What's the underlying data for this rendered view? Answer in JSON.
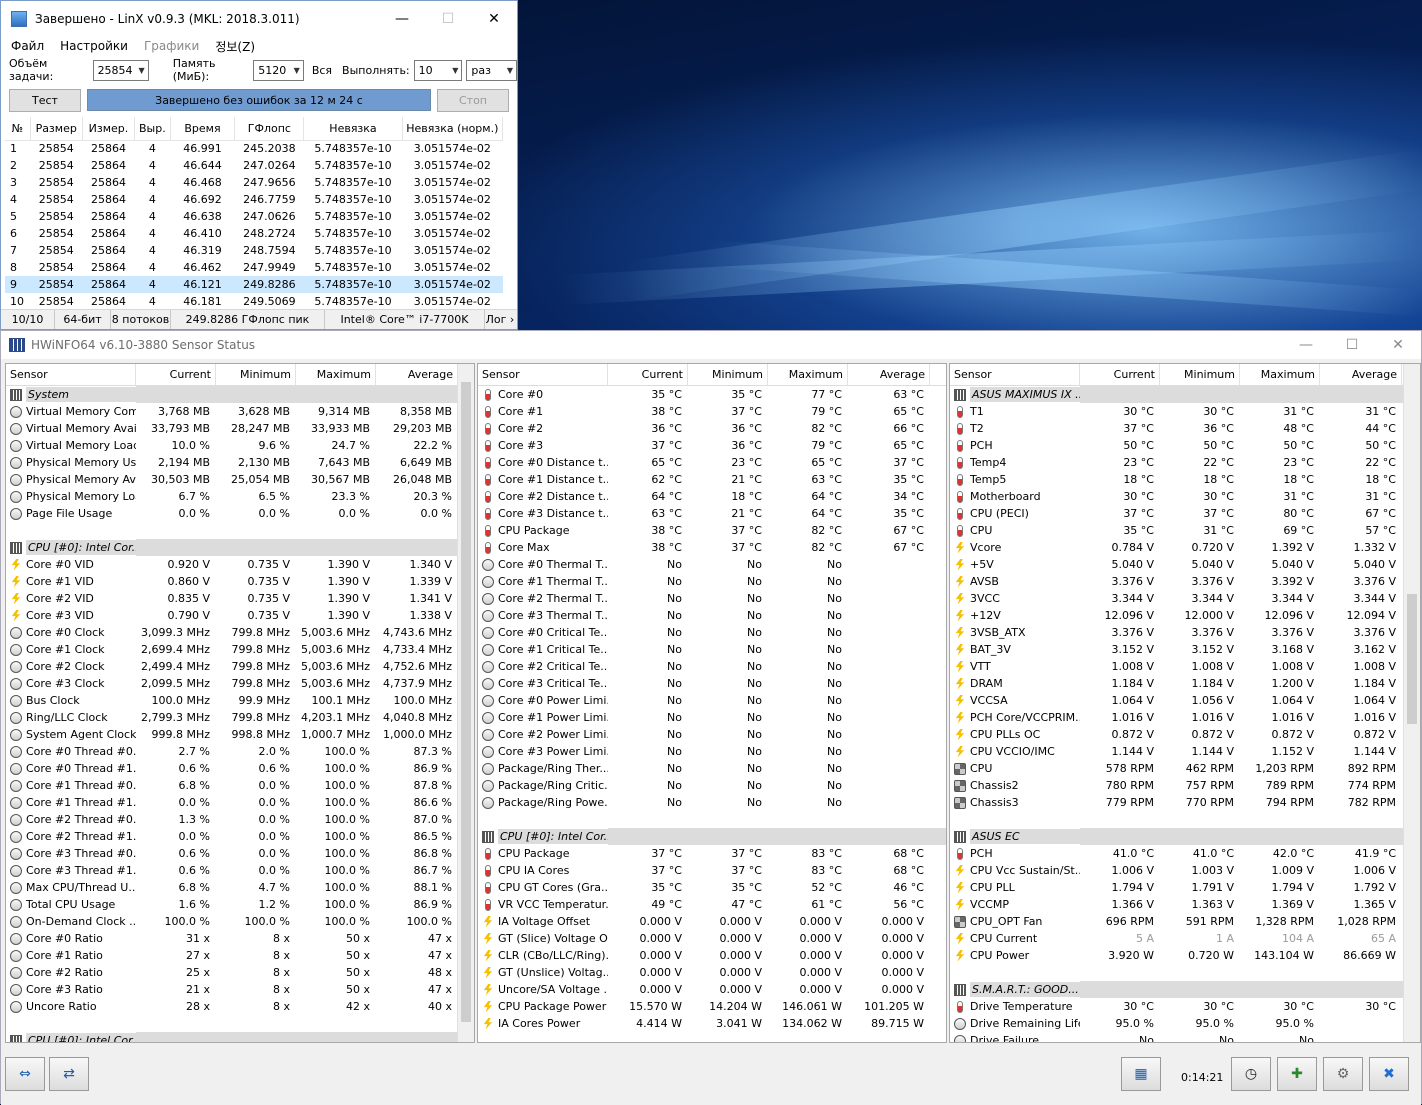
{
  "linx": {
    "title": "Завершено - LinX v0.9.3 (MKL: 2018.3.011)",
    "menu": [
      "Файл",
      "Настройки",
      "Графики",
      "정보(Z)"
    ],
    "params": {
      "size_label": "Объём задачи:",
      "size_value": "25854",
      "memory_label": "Память (МиБ):",
      "memory_value": "5120",
      "all_label": "Вся",
      "run_label": "Выполнять:",
      "run_value": "10",
      "unit_value": "раз"
    },
    "test_label": "Тест",
    "progress_text": "Завершено без ошибок за 12 м 24 с",
    "stop_label": "Стоп",
    "columns": [
      "№",
      "Размер",
      "Измер.",
      "Выр.",
      "Время",
      "ГФлопс",
      "Невязка",
      "Невязка (норм.)"
    ],
    "rows": [
      [
        "1",
        "25854",
        "25864",
        "4",
        "46.991",
        "245.2038",
        "5.748357e-10",
        "3.051574e-02"
      ],
      [
        "2",
        "25854",
        "25864",
        "4",
        "46.644",
        "247.0264",
        "5.748357e-10",
        "3.051574e-02"
      ],
      [
        "3",
        "25854",
        "25864",
        "4",
        "46.468",
        "247.9656",
        "5.748357e-10",
        "3.051574e-02"
      ],
      [
        "4",
        "25854",
        "25864",
        "4",
        "46.692",
        "246.7759",
        "5.748357e-10",
        "3.051574e-02"
      ],
      [
        "5",
        "25854",
        "25864",
        "4",
        "46.638",
        "247.0626",
        "5.748357e-10",
        "3.051574e-02"
      ],
      [
        "6",
        "25854",
        "25864",
        "4",
        "46.410",
        "248.2724",
        "5.748357e-10",
        "3.051574e-02"
      ],
      [
        "7",
        "25854",
        "25864",
        "4",
        "46.319",
        "248.7594",
        "5.748357e-10",
        "3.051574e-02"
      ],
      [
        "8",
        "25854",
        "25864",
        "4",
        "46.462",
        "247.9949",
        "5.748357e-10",
        "3.051574e-02"
      ],
      [
        "9",
        "25854",
        "25864",
        "4",
        "46.121",
        "249.8286",
        "5.748357e-10",
        "3.051574e-02"
      ],
      [
        "10",
        "25854",
        "25864",
        "4",
        "46.181",
        "249.5069",
        "5.748357e-10",
        "3.051574e-02"
      ]
    ],
    "selected_row": 8,
    "status": [
      "10/10",
      "64-бит",
      "8 потоков",
      "249.8286 ГФлопс пик",
      "Intel® Core™ i7-7700K",
      "Лог ›"
    ]
  },
  "hw": {
    "title": "HWiNFO64 v6.10-3880 Sensor Status",
    "columns": [
      "Sensor",
      "Current",
      "Minimum",
      "Maximum",
      "Average"
    ],
    "time": "0:14:21",
    "panels": [
      [
        [
          "g",
          "System"
        ],
        [
          "c",
          "Virtual Memory Com...",
          "3,768 MB",
          "3,628 MB",
          "9,314 MB",
          "8,358 MB"
        ],
        [
          "c",
          "Virtual Memory Avai...",
          "33,793 MB",
          "28,247 MB",
          "33,933 MB",
          "29,203 MB"
        ],
        [
          "c",
          "Virtual Memory Load",
          "10.0 %",
          "9.6 %",
          "24.7 %",
          "22.2 %"
        ],
        [
          "c",
          "Physical Memory Used",
          "2,194 MB",
          "2,130 MB",
          "7,643 MB",
          "6,649 MB"
        ],
        [
          "c",
          "Physical Memory Av...",
          "30,503 MB",
          "25,054 MB",
          "30,567 MB",
          "26,048 MB"
        ],
        [
          "c",
          "Physical Memory Load",
          "6.7 %",
          "6.5 %",
          "23.3 %",
          "20.3 %"
        ],
        [
          "c",
          "Page File Usage",
          "0.0 %",
          "0.0 %",
          "0.0 %",
          "0.0 %"
        ],
        [
          "e"
        ],
        [
          "g",
          "CPU [#0]: Intel Cor..."
        ],
        [
          "b",
          "Core #0 VID",
          "0.920 V",
          "0.735 V",
          "1.390 V",
          "1.340 V"
        ],
        [
          "b",
          "Core #1 VID",
          "0.860 V",
          "0.735 V",
          "1.390 V",
          "1.339 V"
        ],
        [
          "b",
          "Core #2 VID",
          "0.835 V",
          "0.735 V",
          "1.390 V",
          "1.341 V"
        ],
        [
          "b",
          "Core #3 VID",
          "0.790 V",
          "0.735 V",
          "1.390 V",
          "1.338 V"
        ],
        [
          "c",
          "Core #0 Clock",
          "3,099.3 MHz",
          "799.8 MHz",
          "5,003.6 MHz",
          "4,743.6 MHz"
        ],
        [
          "c",
          "Core #1 Clock",
          "2,699.4 MHz",
          "799.8 MHz",
          "5,003.6 MHz",
          "4,733.4 MHz"
        ],
        [
          "c",
          "Core #2 Clock",
          "2,499.4 MHz",
          "799.8 MHz",
          "5,003.6 MHz",
          "4,752.6 MHz"
        ],
        [
          "c",
          "Core #3 Clock",
          "2,099.5 MHz",
          "799.8 MHz",
          "5,003.6 MHz",
          "4,737.9 MHz"
        ],
        [
          "c",
          "Bus Clock",
          "100.0 MHz",
          "99.9 MHz",
          "100.1 MHz",
          "100.0 MHz"
        ],
        [
          "c",
          "Ring/LLC Clock",
          "2,799.3 MHz",
          "799.8 MHz",
          "4,203.1 MHz",
          "4,040.8 MHz"
        ],
        [
          "c",
          "System Agent Clock",
          "999.8 MHz",
          "998.8 MHz",
          "1,000.7 MHz",
          "1,000.0 MHz"
        ],
        [
          "c",
          "Core #0 Thread #0...",
          "2.7 %",
          "2.0 %",
          "100.0 %",
          "87.3 %"
        ],
        [
          "c",
          "Core #0 Thread #1...",
          "0.6 %",
          "0.6 %",
          "100.0 %",
          "86.9 %"
        ],
        [
          "c",
          "Core #1 Thread #0...",
          "6.8 %",
          "0.0 %",
          "100.0 %",
          "87.8 %"
        ],
        [
          "c",
          "Core #1 Thread #1...",
          "0.0 %",
          "0.0 %",
          "100.0 %",
          "86.6 %"
        ],
        [
          "c",
          "Core #2 Thread #0...",
          "1.3 %",
          "0.0 %",
          "100.0 %",
          "87.0 %"
        ],
        [
          "c",
          "Core #2 Thread #1...",
          "0.0 %",
          "0.0 %",
          "100.0 %",
          "86.5 %"
        ],
        [
          "c",
          "Core #3 Thread #0...",
          "0.6 %",
          "0.0 %",
          "100.0 %",
          "86.8 %"
        ],
        [
          "c",
          "Core #3 Thread #1...",
          "0.6 %",
          "0.0 %",
          "100.0 %",
          "86.7 %"
        ],
        [
          "c",
          "Max CPU/Thread U...",
          "6.8 %",
          "4.7 %",
          "100.0 %",
          "88.1 %"
        ],
        [
          "c",
          "Total CPU Usage",
          "1.6 %",
          "1.2 %",
          "100.0 %",
          "86.9 %"
        ],
        [
          "c",
          "On-Demand Clock ...",
          "100.0 %",
          "100.0 %",
          "100.0 %",
          "100.0 %"
        ],
        [
          "c",
          "Core #0 Ratio",
          "31 x",
          "8 x",
          "50 x",
          "47 x"
        ],
        [
          "c",
          "Core #1 Ratio",
          "27 x",
          "8 x",
          "50 x",
          "47 x"
        ],
        [
          "c",
          "Core #2 Ratio",
          "25 x",
          "8 x",
          "50 x",
          "48 x"
        ],
        [
          "c",
          "Core #3 Ratio",
          "21 x",
          "8 x",
          "50 x",
          "47 x"
        ],
        [
          "c",
          "Uncore Ratio",
          "28 x",
          "8 x",
          "42 x",
          "40 x"
        ],
        [
          "e"
        ],
        [
          "g",
          "CPU [#0]: Intel Cor..."
        ]
      ],
      [
        [
          "t",
          "Core #0",
          "35 °C",
          "35 °C",
          "77 °C",
          "63 °C"
        ],
        [
          "t",
          "Core #1",
          "38 °C",
          "37 °C",
          "79 °C",
          "65 °C"
        ],
        [
          "t",
          "Core #2",
          "36 °C",
          "36 °C",
          "82 °C",
          "66 °C"
        ],
        [
          "t",
          "Core #3",
          "37 °C",
          "36 °C",
          "79 °C",
          "65 °C"
        ],
        [
          "t",
          "Core #0 Distance t...",
          "65 °C",
          "23 °C",
          "65 °C",
          "37 °C"
        ],
        [
          "t",
          "Core #1 Distance t...",
          "62 °C",
          "21 °C",
          "63 °C",
          "35 °C"
        ],
        [
          "t",
          "Core #2 Distance t...",
          "64 °C",
          "18 °C",
          "64 °C",
          "34 °C"
        ],
        [
          "t",
          "Core #3 Distance t...",
          "63 °C",
          "21 °C",
          "64 °C",
          "35 °C"
        ],
        [
          "t",
          "CPU Package",
          "38 °C",
          "37 °C",
          "82 °C",
          "67 °C"
        ],
        [
          "t",
          "Core Max",
          "38 °C",
          "37 °C",
          "82 °C",
          "67 °C"
        ],
        [
          "c",
          "Core #0 Thermal T...",
          "No",
          "No",
          "No",
          ""
        ],
        [
          "c",
          "Core #1 Thermal T...",
          "No",
          "No",
          "No",
          ""
        ],
        [
          "c",
          "Core #2 Thermal T...",
          "No",
          "No",
          "No",
          ""
        ],
        [
          "c",
          "Core #3 Thermal T...",
          "No",
          "No",
          "No",
          ""
        ],
        [
          "c",
          "Core #0 Critical Te...",
          "No",
          "No",
          "No",
          ""
        ],
        [
          "c",
          "Core #1 Critical Te...",
          "No",
          "No",
          "No",
          ""
        ],
        [
          "c",
          "Core #2 Critical Te...",
          "No",
          "No",
          "No",
          ""
        ],
        [
          "c",
          "Core #3 Critical Te...",
          "No",
          "No",
          "No",
          ""
        ],
        [
          "c",
          "Core #0 Power Limi...",
          "No",
          "No",
          "No",
          ""
        ],
        [
          "c",
          "Core #1 Power Limi...",
          "No",
          "No",
          "No",
          ""
        ],
        [
          "c",
          "Core #2 Power Limi...",
          "No",
          "No",
          "No",
          ""
        ],
        [
          "c",
          "Core #3 Power Limi...",
          "No",
          "No",
          "No",
          ""
        ],
        [
          "c",
          "Package/Ring Ther...",
          "No",
          "No",
          "No",
          ""
        ],
        [
          "c",
          "Package/Ring Critic...",
          "No",
          "No",
          "No",
          ""
        ],
        [
          "c",
          "Package/Ring Powe...",
          "No",
          "No",
          "No",
          ""
        ],
        [
          "e"
        ],
        [
          "g",
          "CPU [#0]: Intel Cor..."
        ],
        [
          "t",
          "CPU Package",
          "37 °C",
          "37 °C",
          "83 °C",
          "68 °C"
        ],
        [
          "t",
          "CPU IA Cores",
          "37 °C",
          "37 °C",
          "83 °C",
          "68 °C"
        ],
        [
          "t",
          "CPU GT Cores (Gra...",
          "35 °C",
          "35 °C",
          "52 °C",
          "46 °C"
        ],
        [
          "t",
          "VR VCC Temperatur...",
          "49 °C",
          "47 °C",
          "61 °C",
          "56 °C"
        ],
        [
          "b",
          "IA Voltage Offset",
          "0.000 V",
          "0.000 V",
          "0.000 V",
          "0.000 V"
        ],
        [
          "b",
          "GT (Slice) Voltage O...",
          "0.000 V",
          "0.000 V",
          "0.000 V",
          "0.000 V"
        ],
        [
          "b",
          "CLR (CBo/LLC/Ring)...",
          "0.000 V",
          "0.000 V",
          "0.000 V",
          "0.000 V"
        ],
        [
          "b",
          "GT (Unslice) Voltag...",
          "0.000 V",
          "0.000 V",
          "0.000 V",
          "0.000 V"
        ],
        [
          "b",
          "Uncore/SA Voltage ...",
          "0.000 V",
          "0.000 V",
          "0.000 V",
          "0.000 V"
        ],
        [
          "b",
          "CPU Package Power",
          "15.570 W",
          "14.204 W",
          "146.061 W",
          "101.205 W"
        ],
        [
          "b",
          "IA Cores Power",
          "4.414 W",
          "3.041 W",
          "134.062 W",
          "89.715 W"
        ]
      ],
      [
        [
          "g",
          "ASUS MAXIMUS IX ..."
        ],
        [
          "t",
          "T1",
          "30 °C",
          "30 °C",
          "31 °C",
          "31 °C"
        ],
        [
          "t",
          "T2",
          "37 °C",
          "36 °C",
          "48 °C",
          "44 °C"
        ],
        [
          "t",
          "PCH",
          "50 °C",
          "50 °C",
          "50 °C",
          "50 °C"
        ],
        [
          "t",
          "Temp4",
          "23 °C",
          "22 °C",
          "23 °C",
          "22 °C"
        ],
        [
          "t",
          "Temp5",
          "18 °C",
          "18 °C",
          "18 °C",
          "18 °C"
        ],
        [
          "t",
          "Motherboard",
          "30 °C",
          "30 °C",
          "31 °C",
          "31 °C"
        ],
        [
          "t",
          "CPU (PECI)",
          "37 °C",
          "37 °C",
          "80 °C",
          "67 °C"
        ],
        [
          "t",
          "CPU",
          "35 °C",
          "31 °C",
          "69 °C",
          "57 °C"
        ],
        [
          "b",
          "Vcore",
          "0.784 V",
          "0.720 V",
          "1.392 V",
          "1.332 V"
        ],
        [
          "b",
          "+5V",
          "5.040 V",
          "5.040 V",
          "5.040 V",
          "5.040 V"
        ],
        [
          "b",
          "AVSB",
          "3.376 V",
          "3.376 V",
          "3.392 V",
          "3.376 V"
        ],
        [
          "b",
          "3VCC",
          "3.344 V",
          "3.344 V",
          "3.344 V",
          "3.344 V"
        ],
        [
          "b",
          "+12V",
          "12.096 V",
          "12.000 V",
          "12.096 V",
          "12.094 V"
        ],
        [
          "b",
          "3VSB_ATX",
          "3.376 V",
          "3.376 V",
          "3.376 V",
          "3.376 V"
        ],
        [
          "b",
          "BAT_3V",
          "3.152 V",
          "3.152 V",
          "3.168 V",
          "3.162 V"
        ],
        [
          "b",
          "VTT",
          "1.008 V",
          "1.008 V",
          "1.008 V",
          "1.008 V"
        ],
        [
          "b",
          "DRAM",
          "1.184 V",
          "1.184 V",
          "1.200 V",
          "1.184 V"
        ],
        [
          "b",
          "VCCSA",
          "1.064 V",
          "1.056 V",
          "1.064 V",
          "1.064 V"
        ],
        [
          "b",
          "PCH Core/VCCPRIM...",
          "1.016 V",
          "1.016 V",
          "1.016 V",
          "1.016 V"
        ],
        [
          "b",
          "CPU PLLs OC",
          "0.872 V",
          "0.872 V",
          "0.872 V",
          "0.872 V"
        ],
        [
          "b",
          "CPU VCCIO/IMC",
          "1.144 V",
          "1.144 V",
          "1.152 V",
          "1.144 V"
        ],
        [
          "f",
          "CPU",
          "578 RPM",
          "462 RPM",
          "1,203 RPM",
          "892 RPM"
        ],
        [
          "f",
          "Chassis2",
          "780 RPM",
          "757 RPM",
          "789 RPM",
          "774 RPM"
        ],
        [
          "f",
          "Chassis3",
          "779 RPM",
          "770 RPM",
          "794 RPM",
          "782 RPM"
        ],
        [
          "e"
        ],
        [
          "g",
          "ASUS EC"
        ],
        [
          "t",
          "PCH",
          "41.0 °C",
          "41.0 °C",
          "42.0 °C",
          "41.9 °C"
        ],
        [
          "b",
          "CPU Vcc Sustain/St...",
          "1.006 V",
          "1.003 V",
          "1.009 V",
          "1.006 V"
        ],
        [
          "b",
          "CPU PLL",
          "1.794 V",
          "1.791 V",
          "1.794 V",
          "1.792 V"
        ],
        [
          "b",
          "VCCMP",
          "1.366 V",
          "1.363 V",
          "1.369 V",
          "1.365 V"
        ],
        [
          "f",
          "CPU_OPT Fan",
          "696 RPM",
          "591 RPM",
          "1,328 RPM",
          "1,028 RPM"
        ],
        [
          "bg",
          "CPU Current",
          "5 A",
          "1 A",
          "104 A",
          "65 A"
        ],
        [
          "b",
          "CPU Power",
          "3.920 W",
          "0.720 W",
          "143.104 W",
          "86.669 W"
        ],
        [
          "e"
        ],
        [
          "g",
          "S.M.A.R.T.: GOOD..."
        ],
        [
          "t",
          "Drive Temperature",
          "30 °C",
          "30 °C",
          "30 °C",
          "30 °C"
        ],
        [
          "c",
          "Drive Remaining Life",
          "95.0 %",
          "95.0 %",
          "95.0 %",
          ""
        ],
        [
          "c",
          "Drive Failure",
          "No",
          "No",
          "No",
          ""
        ]
      ]
    ]
  }
}
